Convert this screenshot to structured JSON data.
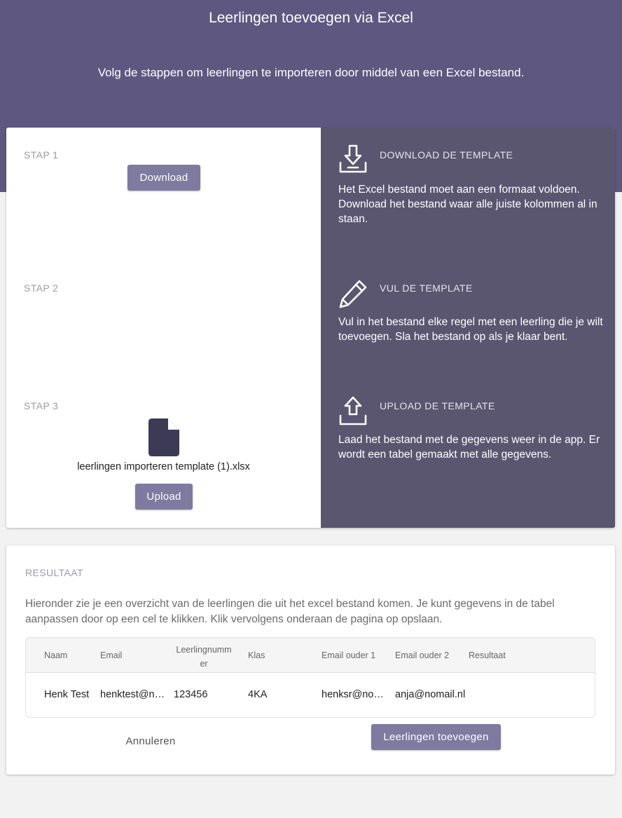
{
  "header": {
    "title": "Leerlingen toevoegen via Excel",
    "subtitle": "Volg de stappen om leerlingen te importeren door middel van een Excel bestand."
  },
  "steps": [
    {
      "label": "STAP 1",
      "button_label": "Download",
      "icon": "download-icon",
      "title": "DOWNLOAD DE TEMPLATE",
      "text": "Het Excel bestand moet aan een formaat voldoen. Download het bestand waar alle juiste kolommen al in staan."
    },
    {
      "label": "STAP 2",
      "icon": "pencil-icon",
      "title": "VUL DE TEMPLATE",
      "text": "Vul in het bestand elke regel met een leerling die je wilt toevoegen. Sla het bestand op als je klaar bent."
    },
    {
      "label": "STAP 3",
      "file_icon": "file-icon",
      "file_name": "leerlingen importeren template (1).xlsx",
      "button_label": "Upload",
      "icon": "upload-icon",
      "title": "UPLOAD DE TEMPLATE",
      "text": "Laad het bestand met de gegevens weer in de app. Er wordt een tabel gemaakt met alle gegevens."
    }
  ],
  "result": {
    "label": "RESULTAAT",
    "description": "Hieronder zie je een overzicht van de leerlingen die uit het excel bestand komen. Je kunt gegevens in de tabel aanpassen door op een cel te klikken. Klik vervolgens onderaan de pagina op opslaan.",
    "columns": [
      "Naam",
      "Email",
      "Leerlingnummer",
      "Klas",
      "Email ouder 1",
      "Email ouder 2",
      "Resultaat"
    ],
    "rows": [
      [
        "Henk Test",
        "henktest@nomail.nl",
        "123456",
        "4KA",
        "henksr@nomail.nl",
        "anja@nomail.nl",
        ""
      ]
    ],
    "cancel_label": "Annuleren",
    "submit_label": "Leerlingen toevoegen"
  },
  "colors": {
    "header_bg": "#5e5880",
    "panel_bg": "#5a5670",
    "button_bg": "#7f7a9f",
    "page_bg": "#f2f2f2"
  }
}
